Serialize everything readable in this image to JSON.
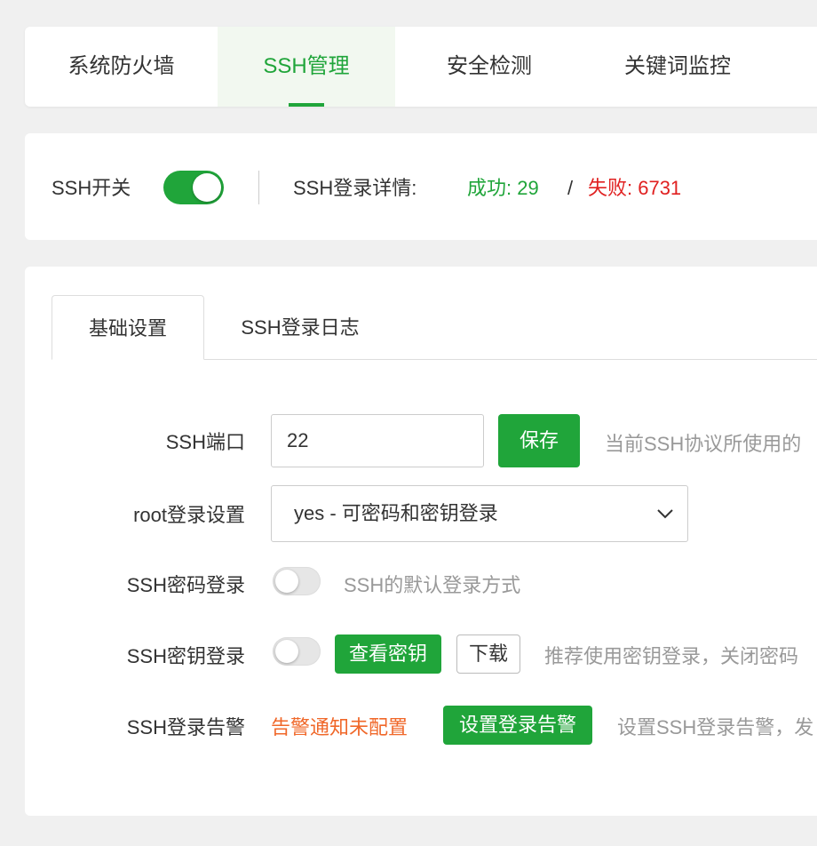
{
  "nav": {
    "tabs": [
      {
        "label": "系统防火墙"
      },
      {
        "label": "SSH管理"
      },
      {
        "label": "安全检测"
      },
      {
        "label": "关键词监控"
      }
    ],
    "active_index": 1
  },
  "status": {
    "switch_label": "SSH开关",
    "switch_on": true,
    "detail_label": "SSH登录详情:",
    "success_label": "成功: 29",
    "separator": "/",
    "fail_label": "失败: 6731"
  },
  "subtabs": [
    {
      "label": "基础设置"
    },
    {
      "label": "SSH登录日志"
    }
  ],
  "settings": {
    "port": {
      "label": "SSH端口",
      "value": "22",
      "save_label": "保存",
      "hint": "当前SSH协议所使用的"
    },
    "root": {
      "label": "root登录设置",
      "selected": "yes - 可密码和密钥登录"
    },
    "password_login": {
      "label": "SSH密码登录",
      "enabled": false,
      "hint": "SSH的默认登录方式"
    },
    "key_login": {
      "label": "SSH密钥登录",
      "enabled": false,
      "view_key_label": "查看密钥",
      "download_label": "下载",
      "hint": "推荐使用密钥登录，关闭密码"
    },
    "alert": {
      "label": "SSH登录告警",
      "status": "告警通知未配置",
      "button_label": "设置登录告警",
      "hint": "设置SSH登录告警，发"
    }
  },
  "colors": {
    "accent": "#20a53a",
    "fail": "#e02020",
    "warn": "#f0682a"
  }
}
